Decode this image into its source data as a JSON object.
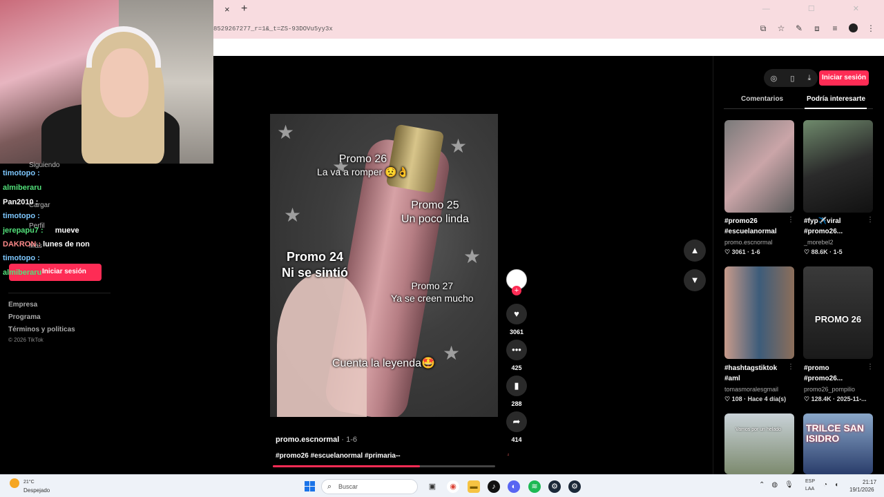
{
  "browser": {
    "tab_close": "×",
    "tab_new": "+",
    "url": "8529267277_r=1&_t=ZS-93DOVu5yy3x",
    "window_buttons": "— ☐ ✕"
  },
  "chat": {
    "lines": [
      {
        "user": "timotopo :",
        "msg": ""
      },
      {
        "user": "almiberaru",
        "msg": ""
      },
      {
        "user": "Pan2010 :",
        "msg": ""
      },
      {
        "user": "timotopo :",
        "msg": ""
      },
      {
        "user": "jerepapu7 :",
        "msg": "mueve"
      },
      {
        "user": "DAKRON :",
        "msg": "lunes de non"
      },
      {
        "user": "timotopo :",
        "msg": ""
      },
      {
        "user": "almiberaru",
        "msg": ""
      }
    ]
  },
  "sidebar": {
    "following": "Siguiendo",
    "upload": "Cargar",
    "profile": "Perfil",
    "more": "Más",
    "login": "Iniciar sesión",
    "footer": [
      "Empresa",
      "Programa",
      "Términos y políticas"
    ],
    "copyright": "© 2026 TikTok"
  },
  "video": {
    "overlays": {
      "promo26": "Promo 26",
      "promo26b": "La va a romper",
      "promo25": "Promo 25",
      "promo25b": "Un poco linda",
      "promo24": "Promo 24",
      "promo24b": "Ni se sintió",
      "promo27": "Promo 27",
      "promo27b": "Ya se creen mucho",
      "legend": "Cuenta la leyenda🤩"
    },
    "author": "promo.escnormal",
    "date": " · 1-6",
    "tags": "#promo26 #escuelanormal #primaria--",
    "progress_fraction": 0.66,
    "likes": "3061",
    "comments": "425",
    "saves": "288",
    "shares": "414"
  },
  "right_panel": {
    "login_button": "Iniciar sesión",
    "tabs": {
      "comments": "Comentarios",
      "interesting": "Podría interesarte"
    },
    "items": [
      {
        "t1": "#promo26",
        "t2": "#escuelanormal",
        "author": "promo.escnormal",
        "stats": "♡ 3061 · 1-6"
      },
      {
        "t1": "#fyp✈️viral",
        "t2": "#promo26...",
        "author": "_morebel2",
        "stats": "♡ 88.6K · 1-5"
      },
      {
        "t1": "#hashtagstiktok",
        "t2": "#aml",
        "author": "tomasmoralesgmail",
        "stats": "♡ 108 · Hace 4 día(s)"
      },
      {
        "t1": "#promo",
        "t2": "#promo26...",
        "author": "promo26_pompilio",
        "stats": "♡ 128.4K · 2025-11-..."
      }
    ],
    "thumb_texts": {
      "promo26_card": "PROMO 26",
      "trilce": "TRILCE SAN ISIDRO",
      "vamos": "Vamos por un helado"
    }
  },
  "taskbar": {
    "temp": "21°C",
    "condition": "Despejado",
    "search": "Buscar",
    "lang1": "ESP",
    "lang2": "LAA",
    "time": "21:17",
    "date": "19/1/2026"
  }
}
